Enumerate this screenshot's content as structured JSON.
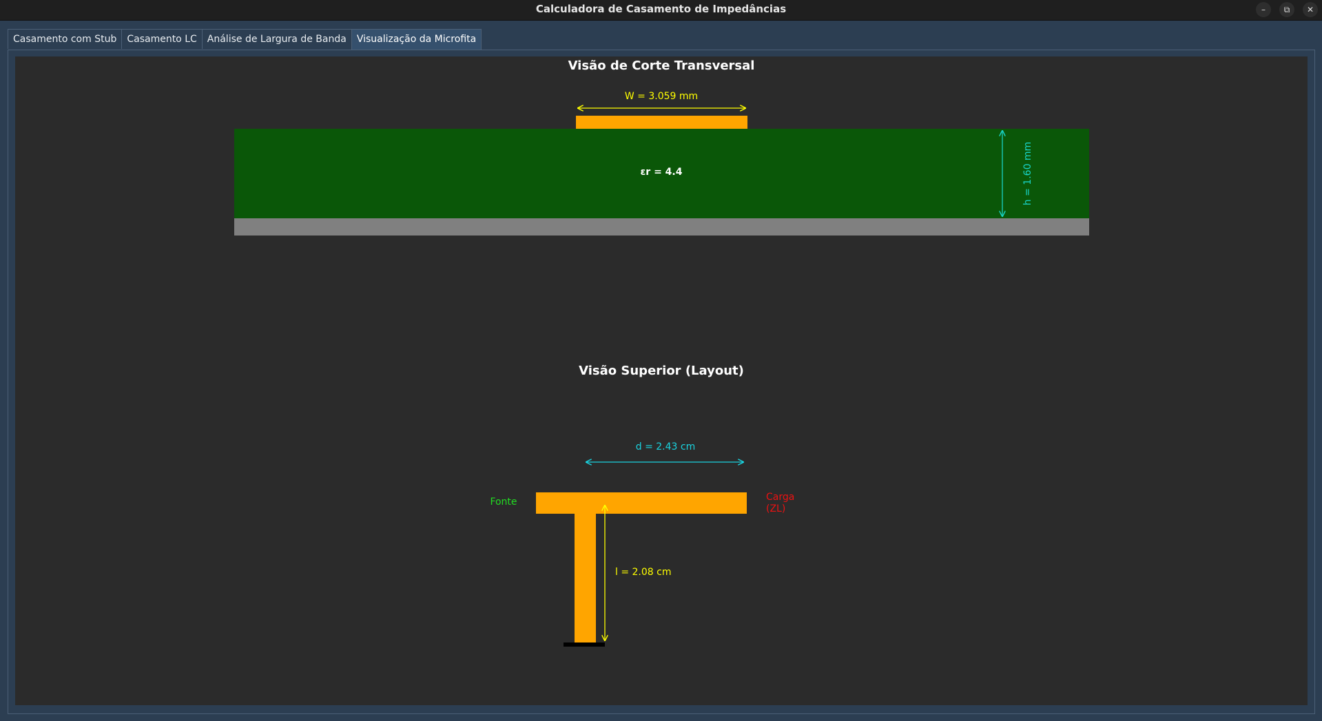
{
  "window": {
    "title": "Calculadora de Casamento de Impedâncias",
    "controls": [
      "–",
      "⧉",
      "✕"
    ]
  },
  "tabs": [
    {
      "label": "Casamento com Stub",
      "active": false
    },
    {
      "label": "Casamento LC",
      "active": false
    },
    {
      "label": "Análise de Largura de Banda",
      "active": false
    },
    {
      "label": "Visualização da Microfita",
      "active": true
    }
  ],
  "cross_section": {
    "title": "Visão de Corte Transversal",
    "width_label": "W = 3.059 mm",
    "er_label": "εr = 4.4",
    "height_label": "h = 1.60 mm",
    "colors": {
      "trace": "#ffa500",
      "substrate": "#0a5708",
      "ground": "#808080",
      "width_dim": "#ffff00",
      "height_dim": "#19d4c8"
    }
  },
  "top_view": {
    "title": "Visão Superior (Layout)",
    "d_label": "d = 2.43 cm",
    "l_label": "l = 2.08 cm",
    "source_label": "Fonte",
    "load_label_line1": "Carga",
    "load_label_line2": "(ZL)",
    "colors": {
      "trace": "#ffa500",
      "source": "#22dd22",
      "load": "#ee1111",
      "d_dim": "#19d4e0",
      "l_dim": "#ffff00"
    }
  }
}
